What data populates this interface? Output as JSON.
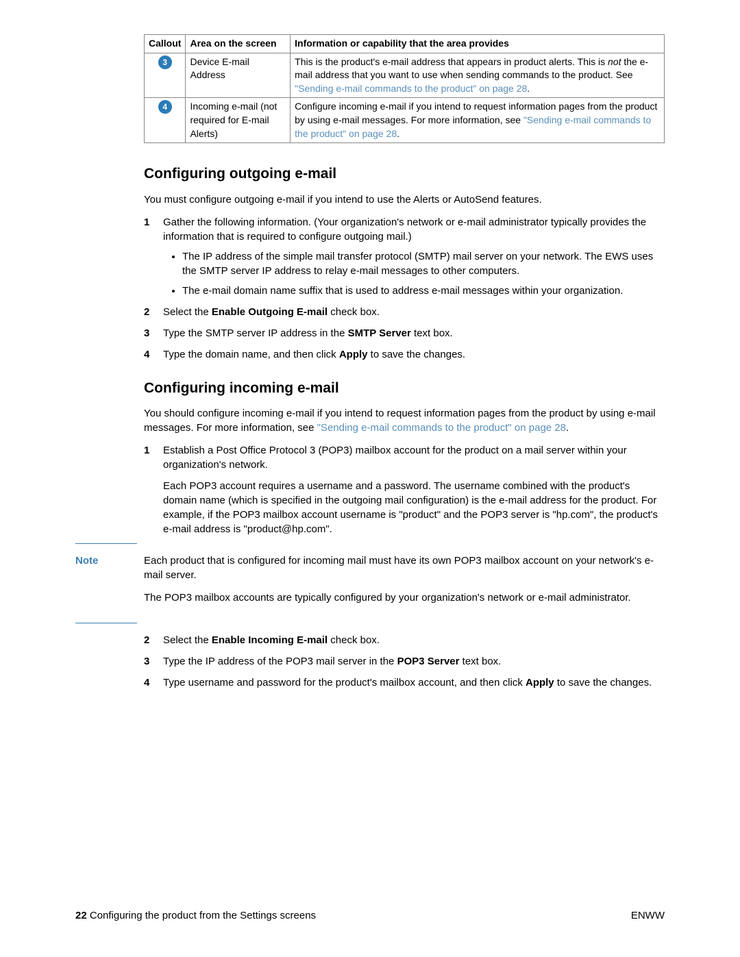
{
  "table": {
    "headers": [
      "Callout",
      "Area on the screen",
      "Information or capability that the area provides"
    ],
    "rows": [
      {
        "callout": "3",
        "area": "Device E-mail Address",
        "info_pre": "This is the product's e-mail address that appears in product alerts. This is ",
        "info_italic": "not",
        "info_mid": " the e-mail address that you want to use when sending commands to the product. See ",
        "info_link": "\"Sending e-mail commands to the product\" on page 28",
        "info_post": "."
      },
      {
        "callout": "4",
        "area": "Incoming e-mail (not required for E-mail Alerts)",
        "info_pre": "Configure incoming e-mail if you intend to request information pages from the product by using e-mail messages. For more information, see ",
        "info_link": "\"Sending e-mail commands to the product\" on page 28",
        "info_post": "."
      }
    ]
  },
  "section1": {
    "heading": "Configuring outgoing e-mail",
    "intro": "You must configure outgoing e-mail if you intend to use the Alerts or AutoSend features.",
    "step1_num": "1",
    "step1": "Gather the following information. (Your organization's network or e-mail administrator typically provides the information that is required to configure outgoing mail.)",
    "bullet1": "The IP address of the simple mail transfer protocol (SMTP) mail server on your network. The EWS uses the SMTP server IP address to relay e-mail messages to other computers.",
    "bullet2": "The e-mail domain name suffix that is used to address e-mail messages within your organization.",
    "step2_num": "2",
    "step2_pre": "Select the ",
    "step2_bold": "Enable Outgoing E-mail",
    "step2_post": " check box.",
    "step3_num": "3",
    "step3_pre": "Type the SMTP server IP address in the ",
    "step3_bold": "SMTP Server",
    "step3_post": " text box.",
    "step4_num": "4",
    "step4_pre": "Type the domain name, and then click ",
    "step4_bold": "Apply",
    "step4_post": " to save the changes."
  },
  "section2": {
    "heading": "Configuring incoming e-mail",
    "intro_pre": "You should configure incoming e-mail if you intend to request information pages from the product by using e-mail messages. For more information, see ",
    "intro_link": "\"Sending e-mail commands to the product\" on page 28",
    "intro_post": ".",
    "step1_num": "1",
    "step1": "Establish a Post Office Protocol 3 (POP3) mailbox account for the product on a mail server within your organization's network.",
    "step1_para": "Each POP3 account requires a username and a password. The username combined with the product's domain name (which is specified in the outgoing mail configuration) is the e-mail address for the product. For example, if the POP3 mailbox account username is \"product\" and the POP3 server is \"hp.com\", the product's e-mail address is \"product@hp.com\".",
    "note_label": "Note",
    "note_p1": "Each product that is configured for incoming mail must have its own POP3 mailbox account on your network's e-mail server.",
    "note_p2": "The POP3 mailbox accounts are typically configured by your organization's network or e-mail administrator.",
    "step2_num": "2",
    "step2_pre": "Select the ",
    "step2_bold": "Enable Incoming E-mail",
    "step2_post": " check box.",
    "step3_num": "3",
    "step3_pre": "Type the IP address of the POP3 mail server in the ",
    "step3_bold": "POP3 Server",
    "step3_post": " text box.",
    "step4_num": "4",
    "step4_pre": "Type username and password for the product's mailbox account, and then click ",
    "step4_bold": "Apply",
    "step4_post": " to save the changes."
  },
  "footer": {
    "page": "22",
    "chapter": " Configuring the product from the Settings screens",
    "right": "ENWW"
  }
}
